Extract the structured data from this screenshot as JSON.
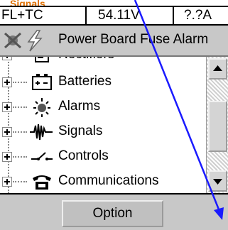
{
  "annotation": {
    "fragment_text": "Signals",
    "arrow_color": "#1a1aff",
    "text_color": "#e07000"
  },
  "status": {
    "mode": "FL+TC",
    "voltage": "54.11V",
    "current": "?.?A"
  },
  "alarm_bar": {
    "message": "Power Board Fuse Alarm",
    "icons": [
      "alarm-off-icon",
      "lightning-icon"
    ]
  },
  "tree": {
    "items": [
      {
        "label": "Rectifiers",
        "icon": "rectifier-icon"
      },
      {
        "label": "Batteries",
        "icon": "battery-icon"
      },
      {
        "label": "Alarms",
        "icon": "alarm-icon"
      },
      {
        "label": "Signals",
        "icon": "signal-icon"
      },
      {
        "label": "Controls",
        "icon": "controls-icon"
      },
      {
        "label": "Communications",
        "icon": "telephone-icon"
      }
    ]
  },
  "footer": {
    "option_label": "Option"
  }
}
